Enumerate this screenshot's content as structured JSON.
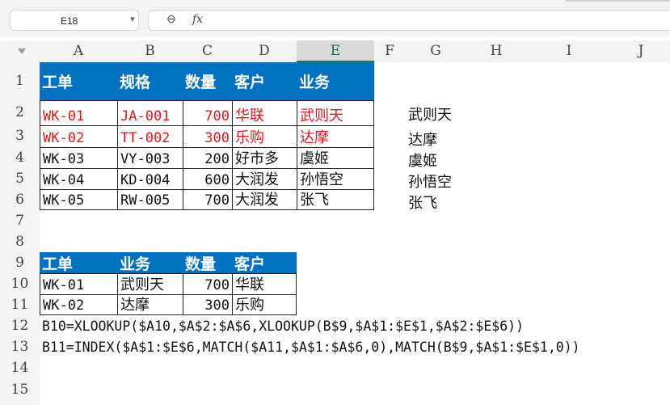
{
  "namebox": {
    "value": "E18",
    "dropdown": "▾"
  },
  "formula_bar": {
    "zoom_icon": "⊖",
    "fx_label": "fx",
    "value": ""
  },
  "columns": [
    "A",
    "B",
    "C",
    "D",
    "E",
    "F",
    "G",
    "H",
    "I",
    "J"
  ],
  "selected_column": "E",
  "rows": [
    "1",
    "2",
    "3",
    "4",
    "5",
    "6",
    "7",
    "8",
    "9",
    "10",
    "11",
    "12",
    "13",
    "14",
    "15"
  ],
  "table1": {
    "headers": [
      "工单",
      "规格",
      "数量",
      "客户",
      "业务"
    ],
    "rows": [
      [
        "WK-01",
        "JA-001",
        "700",
        "华联",
        "武则天"
      ],
      [
        "WK-02",
        "TT-002",
        "300",
        "乐购",
        "达摩"
      ],
      [
        "WK-03",
        "VY-003",
        "200",
        "好市多",
        "虞姬"
      ],
      [
        "WK-04",
        "KD-004",
        "600",
        "大润发",
        "孙悟空"
      ],
      [
        "WK-05",
        "RW-005",
        "700",
        "大润发",
        "张飞"
      ]
    ],
    "highlight_color": "#e0191b",
    "header_color": "#0070c0"
  },
  "g_column": [
    "武则天",
    "达摩",
    "虞姬",
    "孙悟空",
    "张飞"
  ],
  "table2": {
    "headers": [
      "工单",
      "业务",
      "数量",
      "客户"
    ],
    "rows": [
      [
        "WK-01",
        "武则天",
        "700",
        "华联"
      ],
      [
        "WK-02",
        "达摩",
        "300",
        "乐购"
      ]
    ]
  },
  "formulas": {
    "b10": "B10=XLOOKUP($A10,$A$2:$A$6,XLOOKUP(B$9,$A$1:$E$1,$A$2:$E$6))",
    "b11": "B11=INDEX($A$1:$E$6,MATCH($A11,$A$1:$A$6,0),MATCH(B$9,$A$1:$E$1,0))"
  }
}
